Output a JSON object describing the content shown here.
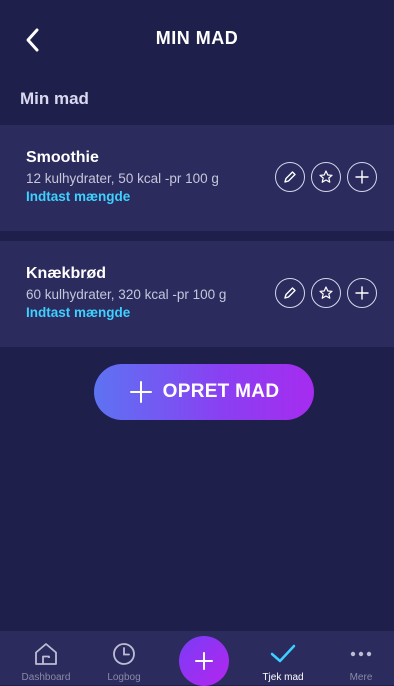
{
  "header": {
    "title": "MIN MAD"
  },
  "section": {
    "title": "Min mad"
  },
  "foods": [
    {
      "name": "Smoothie",
      "desc": "12 kulhydrater, 50 kcal -pr 100 g",
      "link": "Indtast mængde"
    },
    {
      "name": "Knækbrød",
      "desc": "60 kulhydrater, 320 kcal -pr 100 g",
      "link": "Indtast mængde"
    }
  ],
  "create_button": {
    "label": "OPRET MAD"
  },
  "nav": [
    {
      "label": "Dashboard",
      "icon": "home-icon"
    },
    {
      "label": "Logbog",
      "icon": "clock-icon"
    },
    {
      "label": "",
      "icon": "plus-icon"
    },
    {
      "label": "Tjek mad",
      "icon": "check-icon"
    },
    {
      "label": "Mere",
      "icon": "more-icon"
    }
  ],
  "colors": {
    "background": "#1f1f4c",
    "card": "#2b2b5e",
    "link": "#3ed0ff",
    "accent": "#9b34f0"
  }
}
